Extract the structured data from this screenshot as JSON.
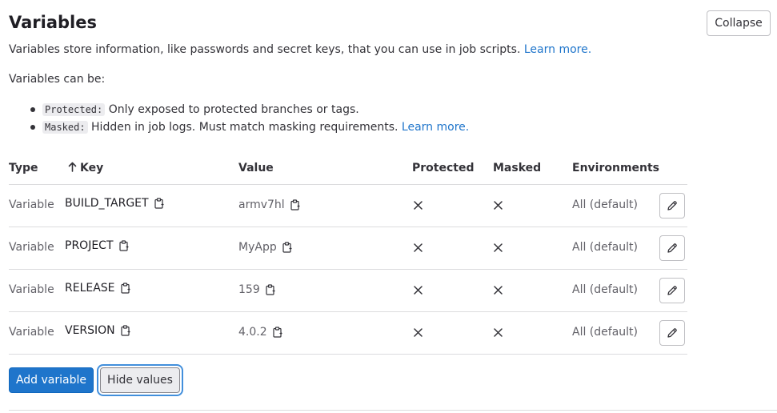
{
  "section": {
    "title": "Variables",
    "collapse_label": "Collapse",
    "description": "Variables store information, like passwords and secret keys, that you can use in job scripts.",
    "learn_more_label": "Learn more.",
    "can_be_label": "Variables can be:",
    "bullets": [
      {
        "code": "Protected:",
        "text": "Only exposed to protected branches or tags."
      },
      {
        "code": "Masked:",
        "text": "Hidden in job logs. Must match masking requirements.",
        "link": "Learn more."
      }
    ]
  },
  "table": {
    "headers": {
      "type": "Type",
      "key": "Key",
      "value": "Value",
      "protected": "Protected",
      "masked": "Masked",
      "environments": "Environments"
    },
    "sort_icon": "arrow-up-icon",
    "rows": [
      {
        "type": "Variable",
        "key": "BUILD_TARGET",
        "value": "armv7hl",
        "protected": false,
        "masked": false,
        "environment": "All (default)"
      },
      {
        "type": "Variable",
        "key": "PROJECT",
        "value": "MyApp",
        "protected": false,
        "masked": false,
        "environment": "All (default)"
      },
      {
        "type": "Variable",
        "key": "RELEASE",
        "value": "159",
        "protected": false,
        "masked": false,
        "environment": "All (default)"
      },
      {
        "type": "Variable",
        "key": "VERSION",
        "value": "4.0.2",
        "protected": false,
        "masked": false,
        "environment": "All (default)"
      }
    ]
  },
  "actions": {
    "add_label": "Add variable",
    "hide_label": "Hide values"
  },
  "colors": {
    "primary": "#1f75cb",
    "link": "#1f75cb",
    "border": "#dcdcde",
    "focus_ring": "#428fdc"
  }
}
